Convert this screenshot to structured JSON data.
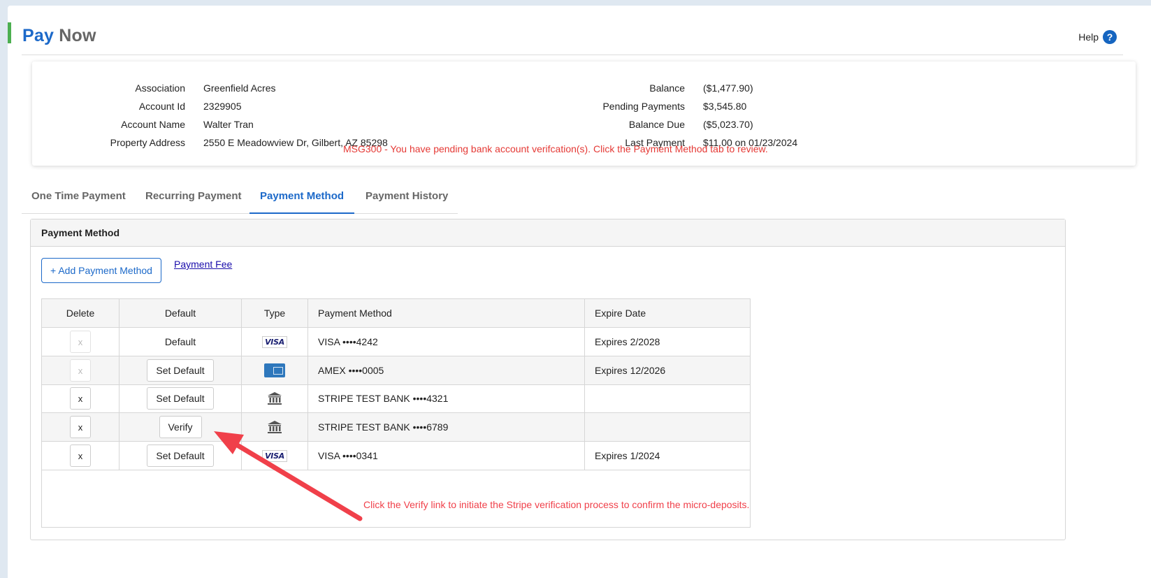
{
  "header": {
    "title_primary": "Pay",
    "title_secondary": "Now",
    "help_label": "Help",
    "help_icon": "question-circle-icon",
    "accent_color": "#4caf50",
    "brand_color": "#1c69c9"
  },
  "account": {
    "association_label": "Association",
    "association_value": "Greenfield Acres",
    "account_id_label": "Account Id",
    "account_id_value": "2329905",
    "account_name_label": "Account Name",
    "account_name_value": "Walter Tran",
    "property_address_label": "Property Address",
    "property_address_value": "2550 E Meadowview Dr, Gilbert, AZ 85298",
    "balance_label": "Balance",
    "balance_value": "($1,477.90)",
    "pending_label": "Pending Payments",
    "pending_value": "$3,545.80",
    "balance_due_label": "Balance Due",
    "balance_due_value": "($5,023.70)",
    "last_payment_label": "Last Payment",
    "last_payment_value": "$11.00 on 01/23/2024",
    "message": "MSG300 - You have pending bank account verifcation(s). Click the Payment Method tab to review."
  },
  "tabs": [
    {
      "label": "One Time Payment",
      "active": false
    },
    {
      "label": "Recurring Payment",
      "active": false
    },
    {
      "label": "Payment Method",
      "active": true
    },
    {
      "label": "Payment History",
      "active": false
    }
  ],
  "panel": {
    "title": "Payment Method",
    "add_button": "+ Add Payment Method",
    "fee_link": "Payment Fee"
  },
  "table": {
    "headers": {
      "delete": "Delete",
      "default": "Default",
      "type": "Type",
      "payment_method": "Payment Method",
      "expire_date": "Expire Date"
    },
    "rows": [
      {
        "delete": "x",
        "delete_enabled": false,
        "default": "Default",
        "default_kind": "text",
        "type_icon": "visa-icon",
        "type_text": "VISA",
        "payment_method": "VISA ••••4242",
        "expire_date": "Expires 2/2028"
      },
      {
        "delete": "x",
        "delete_enabled": false,
        "default": "Set Default",
        "default_kind": "button",
        "type_icon": "amex-icon",
        "type_text": "",
        "payment_method": "AMEX ••••0005",
        "expire_date": "Expires 12/2026"
      },
      {
        "delete": "x",
        "delete_enabled": true,
        "default": "Set Default",
        "default_kind": "button",
        "type_icon": "bank-icon",
        "type_text": "",
        "payment_method": "STRIPE TEST BANK ••••4321",
        "expire_date": ""
      },
      {
        "delete": "x",
        "delete_enabled": true,
        "default": "Verify",
        "default_kind": "button",
        "type_icon": "bank-icon",
        "type_text": "",
        "payment_method": "STRIPE TEST BANK ••••6789",
        "expire_date": ""
      },
      {
        "delete": "x",
        "delete_enabled": true,
        "default": "Set Default",
        "default_kind": "button",
        "type_icon": "visa-icon",
        "type_text": "VISA",
        "payment_method": "VISA ••••0341",
        "expire_date": "Expires 1/2024"
      }
    ]
  },
  "annotation": {
    "text": "Click the Verify link to initiate the Stripe verification process to confirm the micro-deposits.",
    "color": "#f0404a"
  }
}
